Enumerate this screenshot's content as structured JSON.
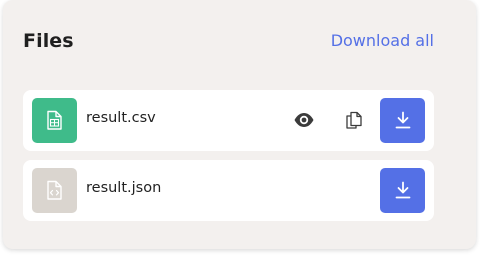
{
  "files_panel": {
    "title": "Files",
    "download_all_label": "Download all",
    "colors": {
      "accent": "#5470e6",
      "csv_icon_bg": "#3fbb8a",
      "json_icon_bg": "#dad5cf",
      "panel_bg": "#f3f0ee"
    },
    "files": [
      {
        "name": "result.csv",
        "type_icon": "spreadsheet-file-icon",
        "actions": [
          "eye-icon",
          "copy-icon",
          "download-icon"
        ]
      },
      {
        "name": "result.json",
        "type_icon": "code-file-icon",
        "actions": [
          "download-icon"
        ]
      }
    ]
  }
}
